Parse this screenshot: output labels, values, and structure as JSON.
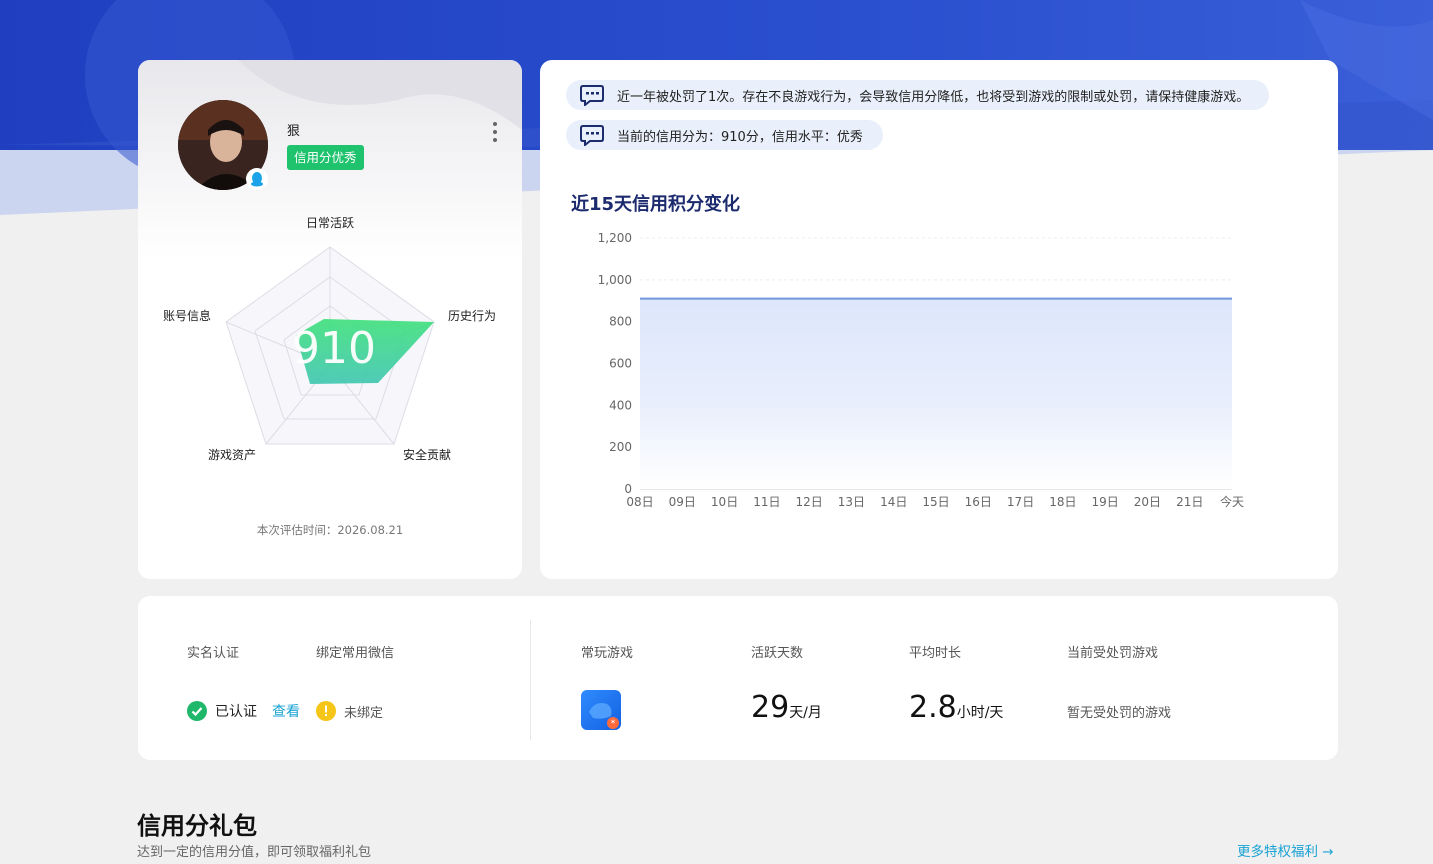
{
  "profile": {
    "username": "狠",
    "credit_badge": "信用分优秀",
    "score": "910",
    "radar_labels": {
      "daily_active": "日常活跃",
      "history": "历史行为",
      "security": "安全贡献",
      "assets": "游戏资产",
      "account": "账号信息"
    },
    "eval_time": "本次评估时间：2026.08.21"
  },
  "notices": [
    "近一年被处罚了1次。存在不良游戏行为，会导致信用分降低，也将受到游戏的限制或处罚，请保持健康游戏。",
    "当前的信用分为：910分，信用水平：优秀"
  ],
  "chart_data": {
    "type": "area",
    "title": "近15天信用积分变化",
    "categories": [
      "08日",
      "09日",
      "10日",
      "11日",
      "12日",
      "13日",
      "14日",
      "15日",
      "16日",
      "17日",
      "18日",
      "19日",
      "20日",
      "21日",
      "今天"
    ],
    "y_ticks": [
      "0",
      "200",
      "400",
      "600",
      "800",
      "1,000",
      "1,200"
    ],
    "ylim": [
      0,
      1200
    ],
    "series": [
      {
        "values": [
          910,
          910,
          910,
          910,
          910,
          910,
          910,
          910,
          910,
          910,
          910,
          910,
          910,
          910,
          910
        ]
      }
    ],
    "line_color": "#6f97dc",
    "fill_color": "#dde6fb",
    "grid": true
  },
  "stats": {
    "realname_label": "实名认证",
    "wechat_label": "绑定常用微信",
    "verified_text": "已认证",
    "view_link": "查看",
    "unbound_text": "未绑定",
    "games_label": "常玩游戏",
    "active_days_label": "活跃天数",
    "active_days_value": "29",
    "active_days_unit": "天/月",
    "avg_time_label": "平均时长",
    "avg_time_value": "2.8",
    "avg_time_unit": "小时/天",
    "penalty_label": "当前受处罚游戏",
    "penalty_value": "暂无受处罚的游戏"
  },
  "gift": {
    "title": "信用分礼包",
    "subtitle": "达到一定的信用分值，即可领取福利礼包",
    "more": "更多特权福利 →"
  },
  "colors": {
    "hero_blue": "#2446c4",
    "badge_green": "#1fc26d",
    "radar_fill": "#3ddc84",
    "link_blue": "#1aa3d4",
    "warn_yellow": "#f5c518"
  }
}
